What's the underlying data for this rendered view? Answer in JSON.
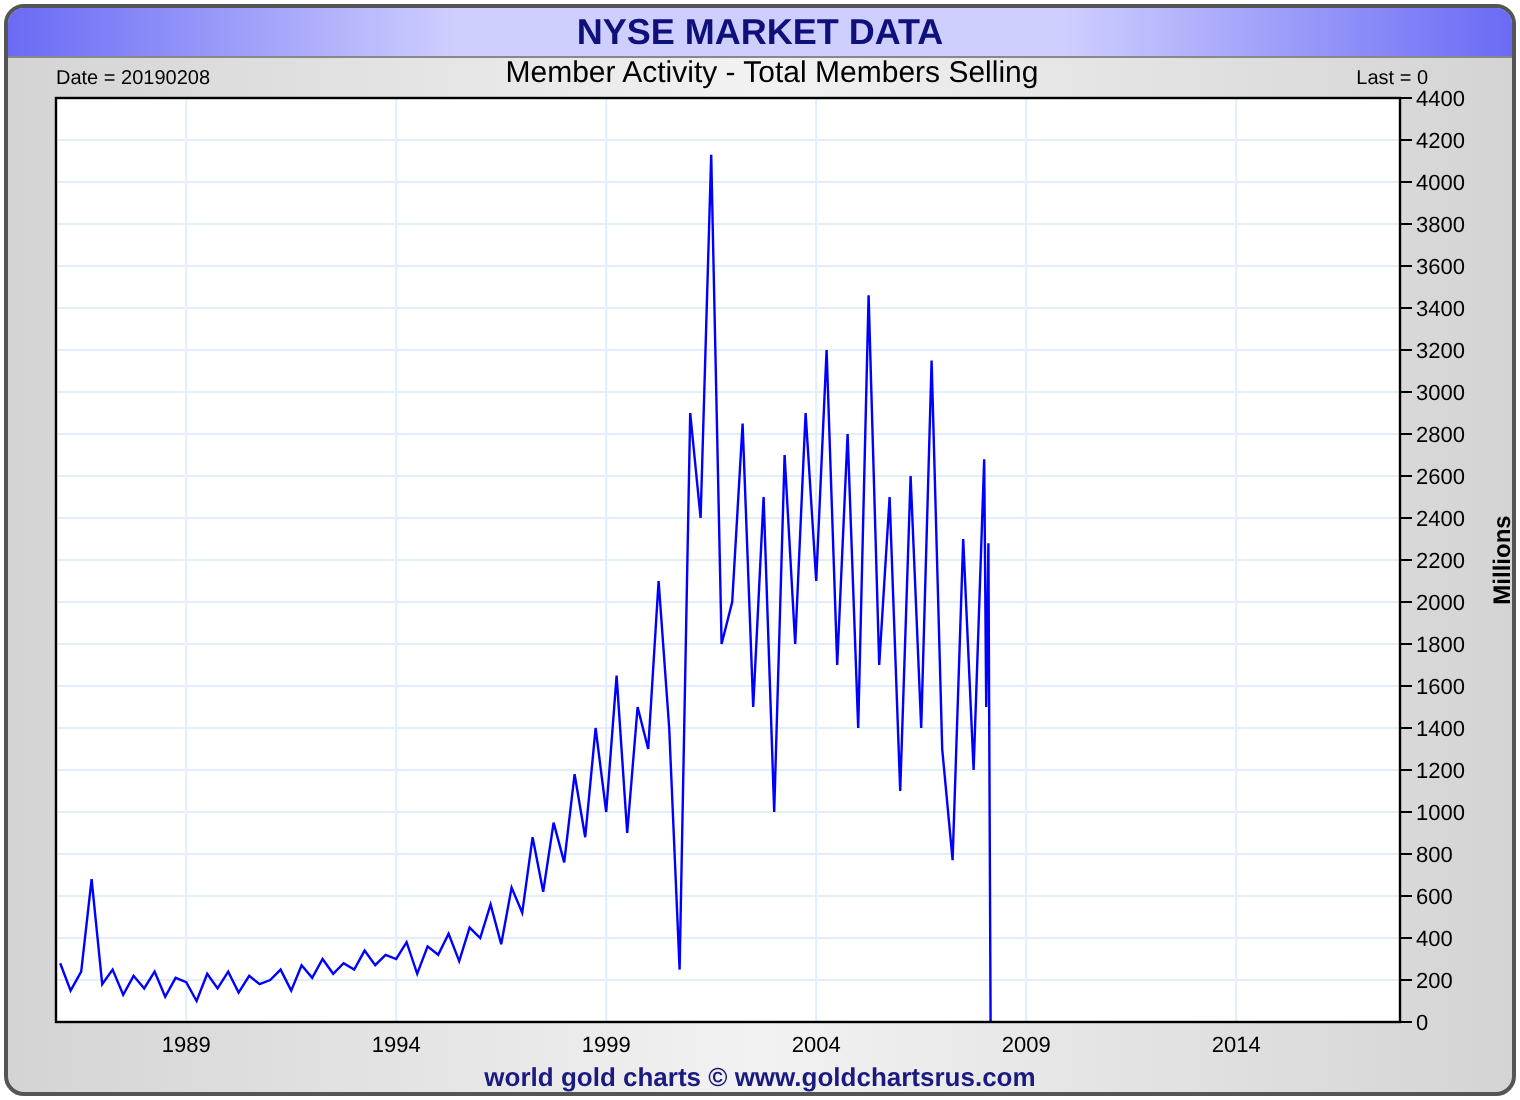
{
  "header": {
    "title": "NYSE MARKET DATA"
  },
  "info": {
    "date": "Date = 20190208",
    "last": "Last = 0"
  },
  "chart": {
    "chart_data": {
      "type": "line",
      "title": "Member Activity - Total Members Selling",
      "ylabel": "Millions",
      "x": [
        1986,
        1986.25,
        1986.5,
        1986.75,
        1987,
        1987.25,
        1987.5,
        1987.75,
        1988,
        1988.25,
        1988.5,
        1988.75,
        1989,
        1989.25,
        1989.5,
        1989.75,
        1990,
        1990.25,
        1990.5,
        1990.75,
        1991,
        1991.25,
        1991.5,
        1991.75,
        1992,
        1992.25,
        1992.5,
        1992.75,
        1993,
        1993.25,
        1993.5,
        1993.75,
        1994,
        1994.25,
        1994.5,
        1994.75,
        1995,
        1995.25,
        1995.5,
        1995.75,
        1996,
        1996.25,
        1996.5,
        1996.75,
        1997,
        1997.25,
        1997.5,
        1997.75,
        1998,
        1998.25,
        1998.5,
        1998.75,
        1999,
        1999.25,
        1999.5,
        1999.75,
        2000,
        2000.25,
        2000.5,
        2000.75,
        2001,
        2001.25,
        2001.5,
        2001.75,
        2002,
        2002.25,
        2002.5,
        2002.75,
        2003,
        2003.25,
        2003.5,
        2003.75,
        2004,
        2004.25,
        2004.5,
        2004.75,
        2005,
        2005.25,
        2005.5,
        2005.75,
        2006,
        2006.25,
        2006.5,
        2006.75,
        2007,
        2007.25,
        2007.5,
        2007.75,
        2008,
        2008.05,
        2008.1,
        2008.15
      ],
      "series": [
        {
          "color": "#0000ff",
          "values": [
            280,
            150,
            240,
            680,
            180,
            250,
            130,
            220,
            160,
            240,
            120,
            210,
            190,
            100,
            230,
            160,
            240,
            140,
            220,
            180,
            200,
            250,
            150,
            270,
            210,
            300,
            230,
            280,
            250,
            340,
            270,
            320,
            300,
            380,
            230,
            360,
            320,
            420,
            290,
            450,
            400,
            560,
            370,
            640,
            520,
            880,
            620,
            950,
            760,
            1180,
            880,
            1400,
            1000,
            1650,
            900,
            1500,
            1300,
            2100,
            1400,
            250,
            2900,
            2400,
            4130,
            1800,
            2000,
            2850,
            1500,
            2500,
            1000,
            2700,
            1800,
            2900,
            2100,
            3200,
            1700,
            2800,
            1400,
            3460,
            1700,
            2500,
            1100,
            2600,
            1400,
            3150,
            1300,
            770,
            2300,
            1200,
            2680,
            1500,
            2280,
            0
          ]
        }
      ],
      "grid": true,
      "xlim": [
        1985.9,
        2017.9
      ],
      "ylim": [
        0,
        4400
      ],
      "xticks": [
        1989,
        1994,
        1999,
        2004,
        2009,
        2014
      ],
      "yticks": [
        0,
        200,
        400,
        600,
        800,
        1000,
        1200,
        1400,
        1600,
        1800,
        2000,
        2200,
        2400,
        2600,
        2800,
        3000,
        3200,
        3400,
        3600,
        3800,
        4000,
        4200,
        4400
      ]
    }
  },
  "footer": {
    "credit": "world gold charts © www.goldchartsrus.com"
  }
}
